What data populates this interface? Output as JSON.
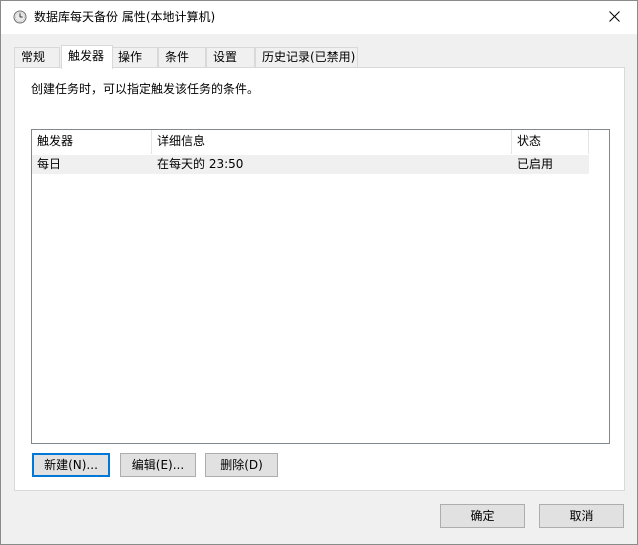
{
  "window": {
    "title": "数据库每天备份 属性(本地计算机)",
    "close_glyph": "✕"
  },
  "tabs": [
    {
      "label": "常规"
    },
    {
      "label": "触发器"
    },
    {
      "label": "操作"
    },
    {
      "label": "条件"
    },
    {
      "label": "设置"
    },
    {
      "label": "历史记录(已禁用)"
    }
  ],
  "panel": {
    "description": "创建任务时，可以指定触发该任务的条件。"
  },
  "trigger_list": {
    "columns": [
      "触发器",
      "详细信息",
      "状态"
    ],
    "rows": [
      {
        "trigger": "每日",
        "details": "在每天的 23:50",
        "status": "已启用"
      }
    ]
  },
  "panel_buttons": {
    "new": "新建(N)...",
    "edit": "编辑(E)...",
    "delete": "删除(D)"
  },
  "dialog_buttons": {
    "ok": "确定",
    "cancel": "取消"
  },
  "colors": {
    "focus_border": "#0078d7",
    "row_highlight": "#f0f0f0"
  }
}
